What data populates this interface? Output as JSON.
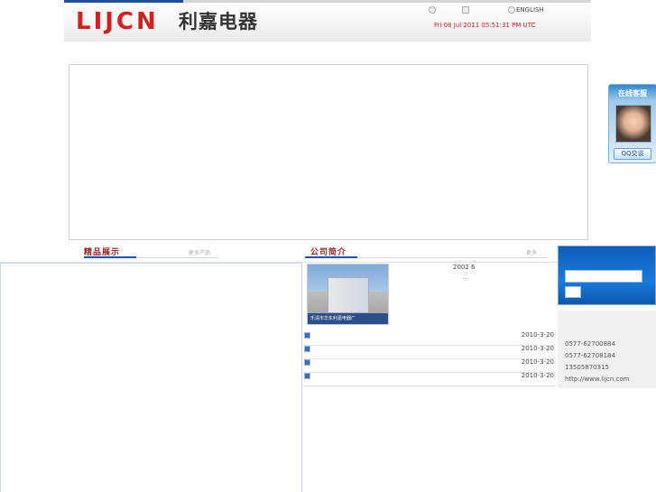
{
  "header": {
    "logo_latin": "LIJCN",
    "logo_chinese": "利嘉电器",
    "language_link": "ENGLISH",
    "datetime": "Fri 08 Jul 2011 05:51:31 PM UTC"
  },
  "products_section": {
    "title": "精品展示",
    "more_label": "更多产品"
  },
  "company_section": {
    "title": "公司简介",
    "more_label": "更多",
    "year_text": "2002 6",
    "ellipsis": "...",
    "photo_caption": "乐清市华东利嘉电器厂"
  },
  "news": [
    {
      "date": "2010-3-20"
    },
    {
      "date": "2010-3-20"
    },
    {
      "date": "2010-3-20"
    },
    {
      "date": "2010-3-20"
    }
  ],
  "online_service": {
    "title": "在线客服",
    "qq_button": "QQ交谈"
  },
  "contact": {
    "phone1": "0577-62700884",
    "phone2": "0577-62708184",
    "mobile": "13505870315",
    "website": "http://www.lijcn.com"
  },
  "colors": {
    "brand_red": "#d41f1f",
    "accent_blue": "#1f57a6",
    "section_title": "#9a1e1e"
  }
}
